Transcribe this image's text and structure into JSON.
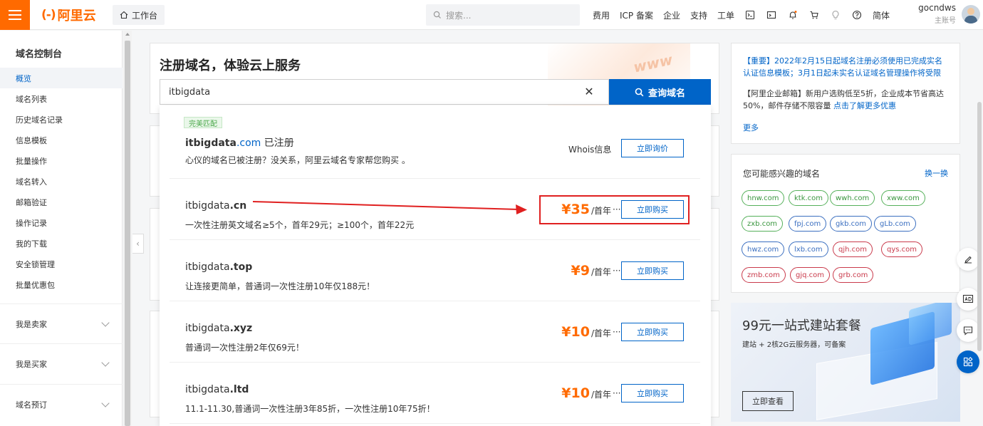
{
  "topbar": {
    "logo_mark": "(-)",
    "logo_text": "阿里云",
    "workbench": "工作台",
    "search_placeholder": "搜索...",
    "nav": [
      "费用",
      "ICP 备案",
      "企业",
      "支持",
      "工单"
    ],
    "lang": "简体",
    "username": "gocndws",
    "user_role": "主账号"
  },
  "sidebar": {
    "title": "域名控制台",
    "items": [
      "概览",
      "域名列表",
      "历史域名记录",
      "信息模板",
      "批量操作",
      "域名转入",
      "邮箱验证",
      "操作记录",
      "我的下载",
      "安全锁管理",
      "批量优惠包"
    ],
    "active_index": 0,
    "groups": [
      "我是卖家",
      "我是买家",
      "域名预订"
    ]
  },
  "hero": {
    "title": "注册域名，体验云上服务",
    "decor_text": "www",
    "query": "itbigdata",
    "query_button": "查询域名"
  },
  "results": {
    "badge": "完美匹配",
    "rows": [
      {
        "base": "itbigdata",
        "tld": ".com",
        "status": "已注册",
        "desc": "心仪的域名已被注册？没关系，阿里云域名专家帮您购买 。",
        "whois": "Whois信息",
        "button": "立即询价"
      },
      {
        "base": "itbigdata",
        "tld": ".cn",
        "price": "¥35",
        "unit": "/首年",
        "more": "···",
        "desc": "一次性注册英文域名≥5个，首年29元；≥100个，首年22元",
        "button": "立即购买"
      },
      {
        "base": "itbigdata",
        "tld": ".top",
        "price": "¥9",
        "unit": "/首年",
        "more": "···",
        "desc": "让连接更简单，普通词一次性注册10年仅188元！",
        "button": "立即购买"
      },
      {
        "base": "itbigdata",
        "tld": ".xyz",
        "price": "¥10",
        "unit": "/首年",
        "more": "···",
        "desc": "普通词一次性注册2年仅69元！",
        "button": "立即购买"
      },
      {
        "base": "itbigdata",
        "tld": ".ltd",
        "price": "¥10",
        "unit": "/首年",
        "more": "···",
        "desc": "11.1-11.30,普通词一次性注册3年85折，一次性注册10年75折！",
        "button": "立即购买"
      }
    ]
  },
  "notices": {
    "important": "【重要】2022年2月15日起域名注册必须使用已完成实名认证信息模板；3月1日起未实名认证域名管理操作将受限",
    "mail_prefix": "【阿里企业邮箱】新用户选购低至5折，企业成本节省高达50%，邮件存储不限容量 ",
    "mail_link": "点击了解更多优惠",
    "more": "更多"
  },
  "interest": {
    "title": "您可能感兴趣的域名",
    "swap": "换一换",
    "tags": [
      {
        "text": "hnw.com",
        "color": "green"
      },
      {
        "text": "ktk.com",
        "color": "green"
      },
      {
        "text": "wwh.com",
        "color": "green"
      },
      {
        "text": "xww.com",
        "color": "green"
      },
      {
        "text": "zxb.com",
        "color": "green"
      },
      {
        "text": "fpj.com",
        "color": "blue"
      },
      {
        "text": "gkb.com",
        "color": "blue"
      },
      {
        "text": "gLb.com",
        "color": "blue"
      },
      {
        "text": "hwz.com",
        "color": "blue"
      },
      {
        "text": "lxb.com",
        "color": "blue"
      },
      {
        "text": "qjh.com",
        "color": "red"
      },
      {
        "text": "qys.com",
        "color": "red"
      },
      {
        "text": "zmb.com",
        "color": "red"
      },
      {
        "text": "gjq.com",
        "color": "red"
      },
      {
        "text": "grb.com",
        "color": "red"
      }
    ]
  },
  "promo": {
    "title": "99元一站式建站套餐",
    "subtitle": "建站 + 2核2G云服务器，可备案",
    "button": "立即查看"
  },
  "colors": {
    "brand": "#ff6a00",
    "primary": "#0064c8",
    "highlight": "#e02020"
  }
}
